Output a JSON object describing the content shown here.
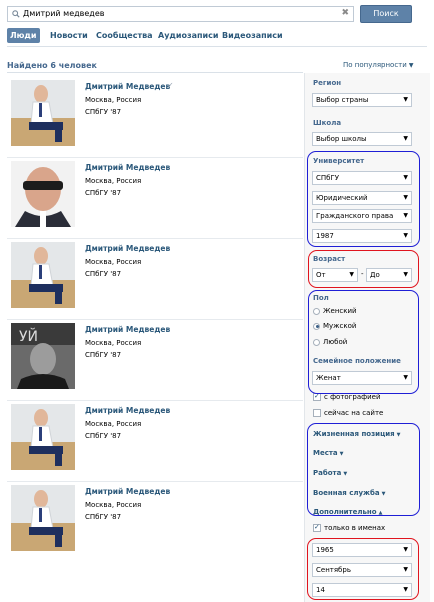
{
  "search": {
    "query": "Дмитрий медведев",
    "button_label": "Поиск",
    "clear_glyph": "✖"
  },
  "tabs": [
    {
      "label": "Люди",
      "active": true
    },
    {
      "label": "Новости",
      "active": false
    },
    {
      "label": "Сообщества",
      "active": false
    },
    {
      "label": "Аудиозаписи",
      "active": false
    },
    {
      "label": "Видеозаписи",
      "active": false
    }
  ],
  "results_header": {
    "found": "Найдено 6 человек",
    "sort": "По популярности"
  },
  "results": [
    {
      "name": "Дмитрий Медведев",
      "city": "Москва, Россия",
      "uni": "СПбГУ '87",
      "verified": "✓",
      "photo": "seated-white-shirt"
    },
    {
      "name": "Дмитрий Медведев",
      "city": "Москва, Россия",
      "uni": "СПбГУ '87",
      "photo": "sunglasses"
    },
    {
      "name": "Дмитрий Медведев",
      "city": "Москва, Россия",
      "uni": "СПбГУ '87",
      "photo": "seated-white-shirt"
    },
    {
      "name": "Дмитрий Медведев",
      "city": "Москва, Россия",
      "uni": "СПбГУ '87",
      "photo": "bw-portrait"
    },
    {
      "name": "Дмитрий Медведев",
      "city": "Москва, Россия",
      "uni": "СПбГУ '87",
      "photo": "seated-white-shirt"
    },
    {
      "name": "Дмитрий Медведев",
      "city": "Москва, Россия",
      "uni": "СПбГУ '87",
      "photo": "seated-white-shirt"
    }
  ],
  "sidebar": {
    "region_label": "Регион",
    "region_value": "Выбор страны",
    "school_label": "Школа",
    "school_value": "Выбор школы",
    "university_label": "Университет",
    "university": [
      "СПбГУ",
      "Юридический",
      "Гражданского права",
      "1987"
    ],
    "age_label": "Возраст",
    "age_from": "От",
    "age_dash": "-",
    "age_to": "До",
    "gender_label": "Пол",
    "gender_options": [
      {
        "label": "Женский",
        "selected": false
      },
      {
        "label": "Мужской",
        "selected": true
      },
      {
        "label": "Любой",
        "selected": false
      }
    ],
    "marital_label": "Семейное положение",
    "marital_value": "Женат",
    "with_photo": "с фотографией",
    "online_now": "сейчас на сайте",
    "life_position": "Жизненная позиция",
    "places": "Места",
    "work": "Работа",
    "military": "Военная служба",
    "additional": "Дополнительно",
    "names_only": "только в именах",
    "birth_year": "1965",
    "birth_month": "Сентябрь",
    "birth_day": "14"
  },
  "colors": {
    "accent": "#5e82a8",
    "link": "#2b587a",
    "annotation_blue": "#1f1fd6",
    "annotation_red": "#e0141e"
  }
}
